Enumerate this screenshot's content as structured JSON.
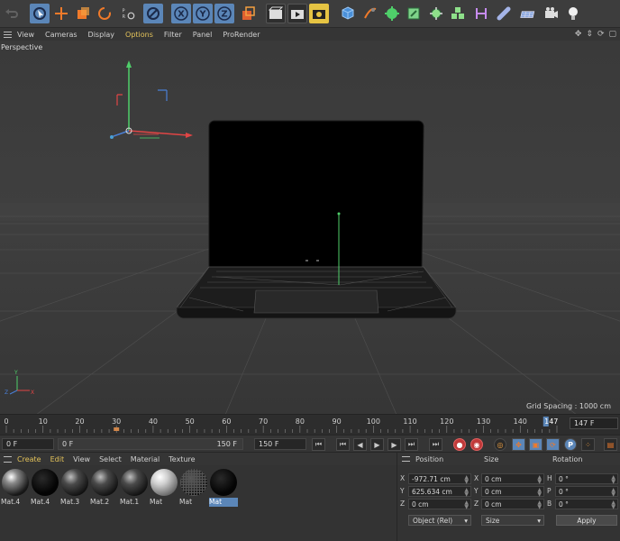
{
  "menubar": {
    "items": [
      {
        "label": "View",
        "active": false
      },
      {
        "label": "Cameras",
        "active": false
      },
      {
        "label": "Display",
        "active": false
      },
      {
        "label": "Options",
        "active": true
      },
      {
        "label": "Filter",
        "active": false
      },
      {
        "label": "Panel",
        "active": false
      },
      {
        "label": "ProRender",
        "active": false
      }
    ]
  },
  "toolbar": {
    "icons": [
      "undo-icon",
      "live-selection-icon",
      "move-icon",
      "scale-icon",
      "rotate-icon",
      "recent-tools-icon",
      "select-icon",
      "x-axis-lock-icon",
      "y-axis-lock-icon",
      "z-axis-lock-icon",
      "coordinate-system-icon",
      "render-view-icon",
      "render-picture-viewer-icon",
      "render-settings-icon",
      "cube-icon",
      "pen-spline-icon",
      "subdivision-icon",
      "extrude-icon",
      "array-icon",
      "cloner-icon",
      "deformer-icon",
      "bend-icon",
      "floor-icon",
      "camera-icon",
      "light-icon"
    ],
    "axis_labels": [
      "X",
      "Y",
      "Z"
    ]
  },
  "viewport": {
    "label": "Perspective",
    "grid_spacing": "Grid Spacing : 1000 cm"
  },
  "timeline": {
    "ticks": [
      "0",
      "10",
      "20",
      "30",
      "40",
      "50",
      "60",
      "70",
      "80",
      "90",
      "100",
      "110",
      "120",
      "130",
      "140"
    ],
    "current_frame_marker": "147",
    "current_frame_field": "147 F",
    "min_frame": 0,
    "max_frame": 150,
    "current_frame": 147
  },
  "transport": {
    "start_field": "0 F",
    "range_start": "0 F",
    "range_end": "150 F",
    "end_field": "150 F"
  },
  "materials": {
    "menu": [
      {
        "label": "Create",
        "active": true
      },
      {
        "label": "Edit",
        "active": true
      },
      {
        "label": "View",
        "active": false
      },
      {
        "label": "Select",
        "active": false
      },
      {
        "label": "Material",
        "active": false
      },
      {
        "label": "Texture",
        "active": false
      }
    ],
    "items": [
      {
        "label": "Mat.4",
        "style": "shiny"
      },
      {
        "label": "Mat.4",
        "style": "black"
      },
      {
        "label": "Mat.3",
        "style": "dark"
      },
      {
        "label": "Mat.2",
        "style": "dark"
      },
      {
        "label": "Mat.1",
        "style": "dark"
      },
      {
        "label": "Mat",
        "style": "silver"
      },
      {
        "label": "Mat",
        "style": "mesh"
      },
      {
        "label": "Mat",
        "style": "black",
        "selected": true
      }
    ]
  },
  "attributes": {
    "headers": {
      "position": "Position",
      "size": "Size",
      "rotation": "Rotation"
    },
    "rows": [
      {
        "pos_axis": "X",
        "pos_value": "-972.71 cm",
        "size_axis": "X",
        "size_value": "0 cm",
        "rot_axis": "H",
        "rot_value": "0 °"
      },
      {
        "pos_axis": "Y",
        "pos_value": "625.634 cm",
        "size_axis": "Y",
        "size_value": "0 cm",
        "rot_axis": "P",
        "rot_value": "0 °"
      },
      {
        "pos_axis": "Z",
        "pos_value": "0 cm",
        "size_axis": "Z",
        "size_value": "0 cm",
        "rot_axis": "B",
        "rot_value": "0 °"
      }
    ],
    "coord_mode": "Object (Rel)",
    "size_mode": "Size",
    "apply_label": "Apply"
  },
  "colors": {
    "accent_blue": "#5b86b8",
    "accent_yellow": "#e4c35a",
    "x_axis": "#e04545",
    "y_axis": "#4fcf6a",
    "z_axis": "#4a7fd6"
  }
}
